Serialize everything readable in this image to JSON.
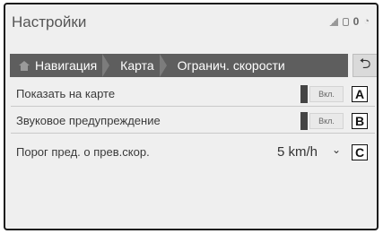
{
  "title": "Настройки",
  "status": {
    "number": "0"
  },
  "breadcrumb": {
    "items": [
      "Навигация",
      "Карта",
      "Огранич. скорости"
    ]
  },
  "back_symbol": "⮌",
  "rows": [
    {
      "label": "Показать на карте",
      "toggle_text": "Вкл.",
      "callout": "A"
    },
    {
      "label": "Звуковое предупреждение",
      "toggle_text": "Вкл.",
      "callout": "B"
    },
    {
      "label": "Порог пред. о прев.скор.",
      "value": "5 km/h",
      "callout": "C"
    }
  ],
  "chevron": "⌄"
}
